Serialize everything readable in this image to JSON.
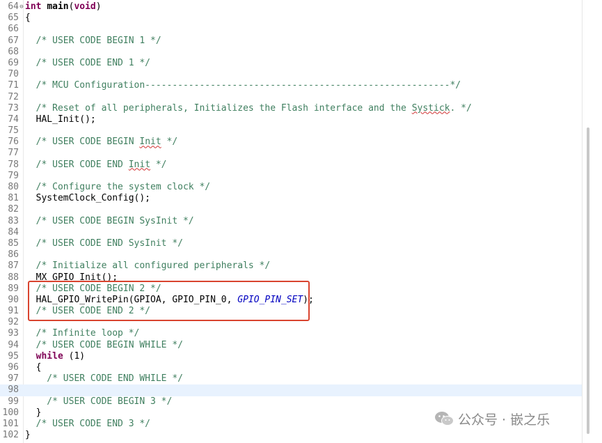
{
  "editor": {
    "current_line": "98",
    "lines": [
      {
        "n": "64",
        "fold": "⊖",
        "tokens": [
          {
            "t": "int",
            "c": "kw"
          },
          {
            "t": " ",
            "c": ""
          },
          {
            "t": "main",
            "c": "fn-bold"
          },
          {
            "t": "(",
            "c": ""
          },
          {
            "t": "void",
            "c": "kw"
          },
          {
            "t": ")",
            "c": ""
          }
        ]
      },
      {
        "n": "65",
        "tokens": [
          {
            "t": "{",
            "c": ""
          }
        ]
      },
      {
        "n": "66",
        "tokens": []
      },
      {
        "n": "67",
        "tokens": [
          {
            "t": "  /* USER CODE BEGIN 1 */",
            "c": "cm"
          }
        ]
      },
      {
        "n": "68",
        "tokens": []
      },
      {
        "n": "69",
        "tokens": [
          {
            "t": "  /* USER CODE END 1 */",
            "c": "cm"
          }
        ]
      },
      {
        "n": "70",
        "tokens": []
      },
      {
        "n": "71",
        "tokens": [
          {
            "t": "  /* MCU Configuration--------------------------------------------------------*/",
            "c": "cm"
          }
        ]
      },
      {
        "n": "72",
        "tokens": []
      },
      {
        "n": "73",
        "tokens": [
          {
            "t": "  /* Reset of all peripherals, Initializes the Flash interface and the ",
            "c": "cm"
          },
          {
            "t": "Systick",
            "c": "cm squig"
          },
          {
            "t": ". */",
            "c": "cm"
          }
        ]
      },
      {
        "n": "74",
        "tokens": [
          {
            "t": "  HAL_Init();",
            "c": ""
          }
        ]
      },
      {
        "n": "75",
        "tokens": []
      },
      {
        "n": "76",
        "tokens": [
          {
            "t": "  /* USER CODE BEGIN ",
            "c": "cm"
          },
          {
            "t": "Init",
            "c": "cm squig"
          },
          {
            "t": " */",
            "c": "cm"
          }
        ]
      },
      {
        "n": "77",
        "tokens": []
      },
      {
        "n": "78",
        "tokens": [
          {
            "t": "  /* USER CODE END ",
            "c": "cm"
          },
          {
            "t": "Init",
            "c": "cm squig"
          },
          {
            "t": " */",
            "c": "cm"
          }
        ]
      },
      {
        "n": "79",
        "tokens": []
      },
      {
        "n": "80",
        "tokens": [
          {
            "t": "  /* Configure the system clock */",
            "c": "cm"
          }
        ]
      },
      {
        "n": "81",
        "tokens": [
          {
            "t": "  SystemClock_Config();",
            "c": ""
          }
        ]
      },
      {
        "n": "82",
        "tokens": []
      },
      {
        "n": "83",
        "tokens": [
          {
            "t": "  /* USER CODE BEGIN SysInit */",
            "c": "cm"
          }
        ]
      },
      {
        "n": "84",
        "tokens": []
      },
      {
        "n": "85",
        "tokens": [
          {
            "t": "  /* USER CODE END SysInit */",
            "c": "cm"
          }
        ]
      },
      {
        "n": "86",
        "tokens": []
      },
      {
        "n": "87",
        "tokens": [
          {
            "t": "  /* Initialize all configured peripherals */",
            "c": "cm"
          }
        ]
      },
      {
        "n": "88",
        "tokens": [
          {
            "t": "  MX_GPIO_Init();",
            "c": ""
          }
        ]
      },
      {
        "n": "89",
        "tokens": [
          {
            "t": "  /* USER CODE BEGIN 2 */",
            "c": "cm"
          }
        ]
      },
      {
        "n": "90",
        "tokens": [
          {
            "t": "  HAL_GPIO_WritePin(GPIOA, GPIO_PIN_0, ",
            "c": ""
          },
          {
            "t": "GPIO_PIN_SET",
            "c": "const"
          },
          {
            "t": ");",
            "c": ""
          }
        ]
      },
      {
        "n": "91",
        "tokens": [
          {
            "t": "  /* USER CODE END 2 */",
            "c": "cm"
          }
        ]
      },
      {
        "n": "92",
        "tokens": []
      },
      {
        "n": "93",
        "tokens": [
          {
            "t": "  /* Infinite loop */",
            "c": "cm"
          }
        ]
      },
      {
        "n": "94",
        "tokens": [
          {
            "t": "  /* USER CODE BEGIN WHILE */",
            "c": "cm"
          }
        ]
      },
      {
        "n": "95",
        "tokens": [
          {
            "t": "  ",
            "c": ""
          },
          {
            "t": "while",
            "c": "kw"
          },
          {
            "t": " (1)",
            "c": ""
          }
        ]
      },
      {
        "n": "96",
        "tokens": [
          {
            "t": "  {",
            "c": ""
          }
        ]
      },
      {
        "n": "97",
        "tokens": [
          {
            "t": "    /* USER CODE END WHILE */",
            "c": "cm"
          }
        ]
      },
      {
        "n": "98",
        "tokens": []
      },
      {
        "n": "99",
        "tokens": [
          {
            "t": "    /* USER CODE BEGIN 3 */",
            "c": "cm"
          }
        ]
      },
      {
        "n": "100",
        "tokens": [
          {
            "t": "  }",
            "c": ""
          }
        ]
      },
      {
        "n": "101",
        "tokens": [
          {
            "t": "  /* USER CODE END 3 */",
            "c": "cm"
          }
        ]
      },
      {
        "n": "102",
        "tokens": [
          {
            "t": "}",
            "c": ""
          }
        ]
      }
    ]
  },
  "watermark": {
    "text": "公众号 · 嵌之乐",
    "icon": "wechat-logo-icon"
  },
  "colors": {
    "keyword": "#7f0055",
    "comment": "#3f7f5f",
    "constant": "#0000c0",
    "highlight_box": "#d9442f",
    "current_line": "#e8f2fe"
  }
}
